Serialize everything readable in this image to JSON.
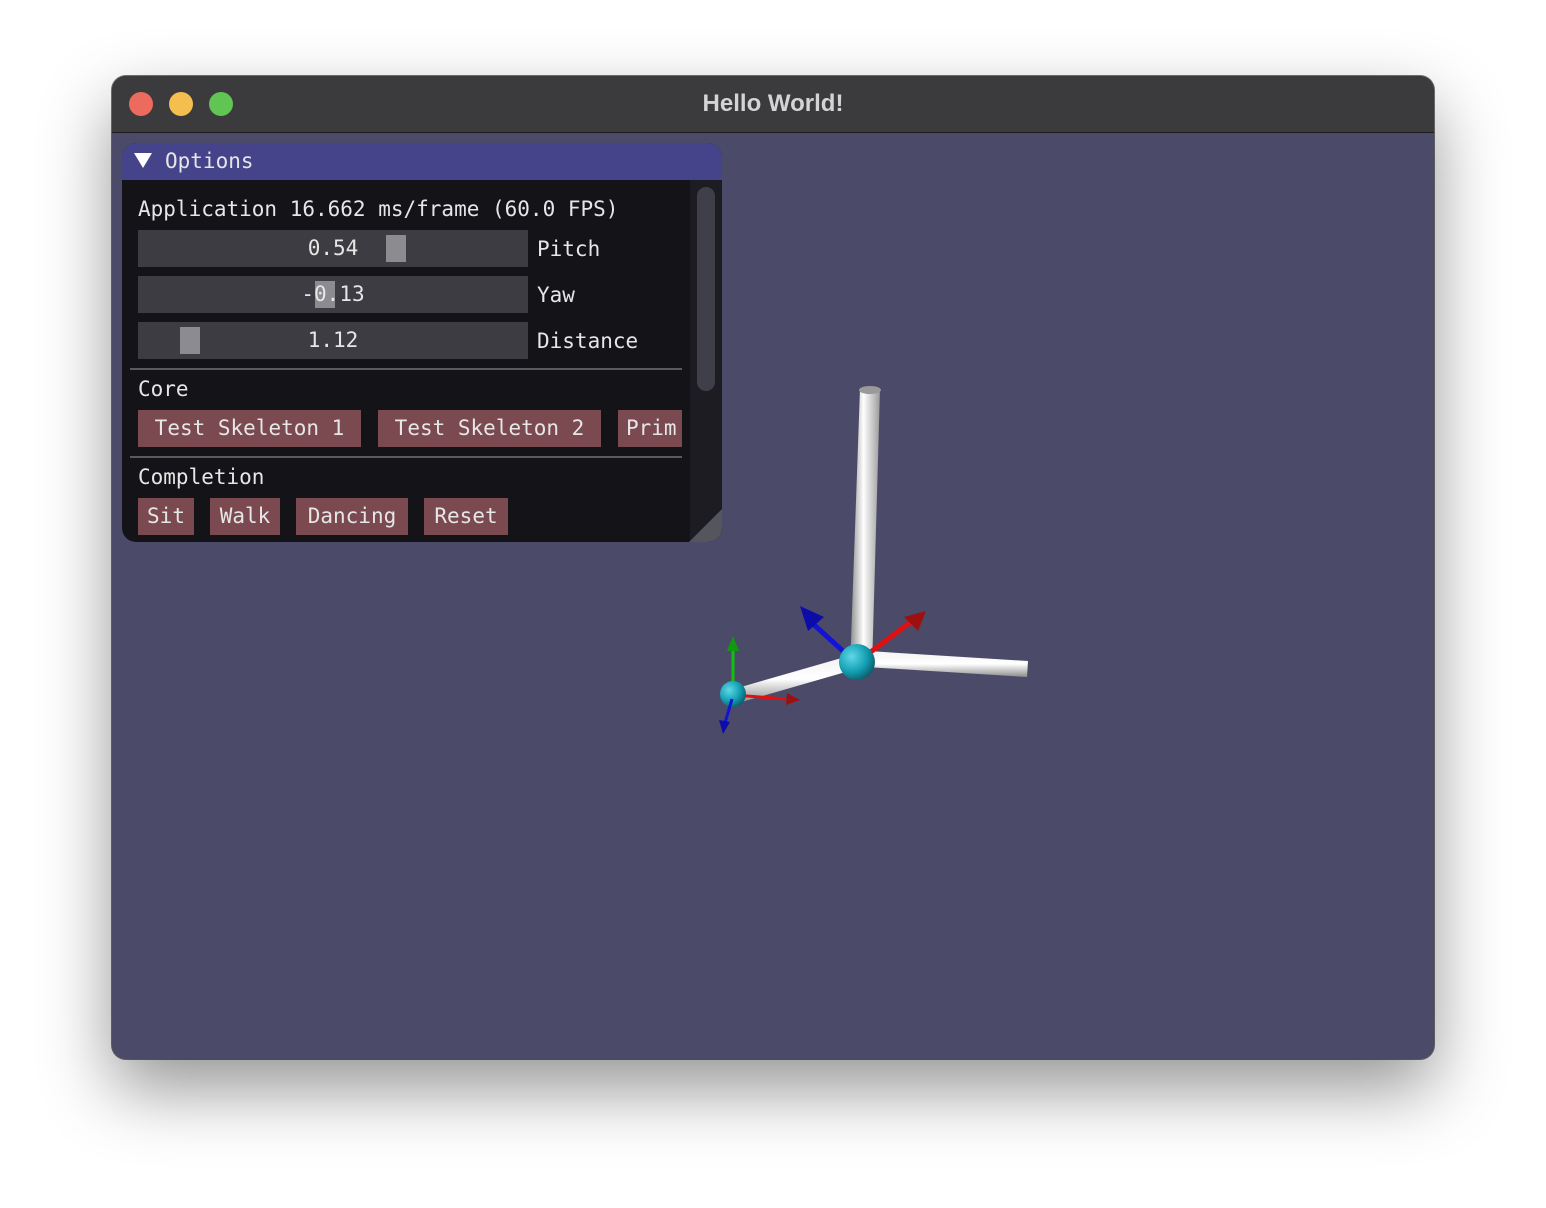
{
  "window": {
    "title": "Hello World!",
    "background_color": "#4b4b69"
  },
  "panel": {
    "title": "Options",
    "stats_text": "Application 16.662 ms/frame (60.0 FPS)",
    "sliders": {
      "pitch": {
        "label": "Pitch",
        "value": "0.54",
        "fraction": 0.6
      },
      "yaw": {
        "label": "Yaw",
        "value": "-0.13",
        "fraction": 0.48
      },
      "distance": {
        "label": "Distance",
        "value": "1.12",
        "fraction": 0.11
      }
    },
    "core": {
      "header": "Core",
      "buttons": [
        "Test Skeleton 1",
        "Test Skeleton 2",
        "Prim"
      ]
    },
    "completion": {
      "header": "Completion",
      "buttons": [
        "Sit",
        "Walk",
        "Dancing",
        "Reset"
      ]
    }
  },
  "colors": {
    "panel_header": "#45448a",
    "button": "#7a4a50",
    "slider_bg": "#3c3c42",
    "axis_x": "#e01010",
    "axis_y": "#10c010",
    "axis_z": "#1010e0",
    "joint": "#1aa0b4",
    "bone": "#dcdcdc"
  }
}
